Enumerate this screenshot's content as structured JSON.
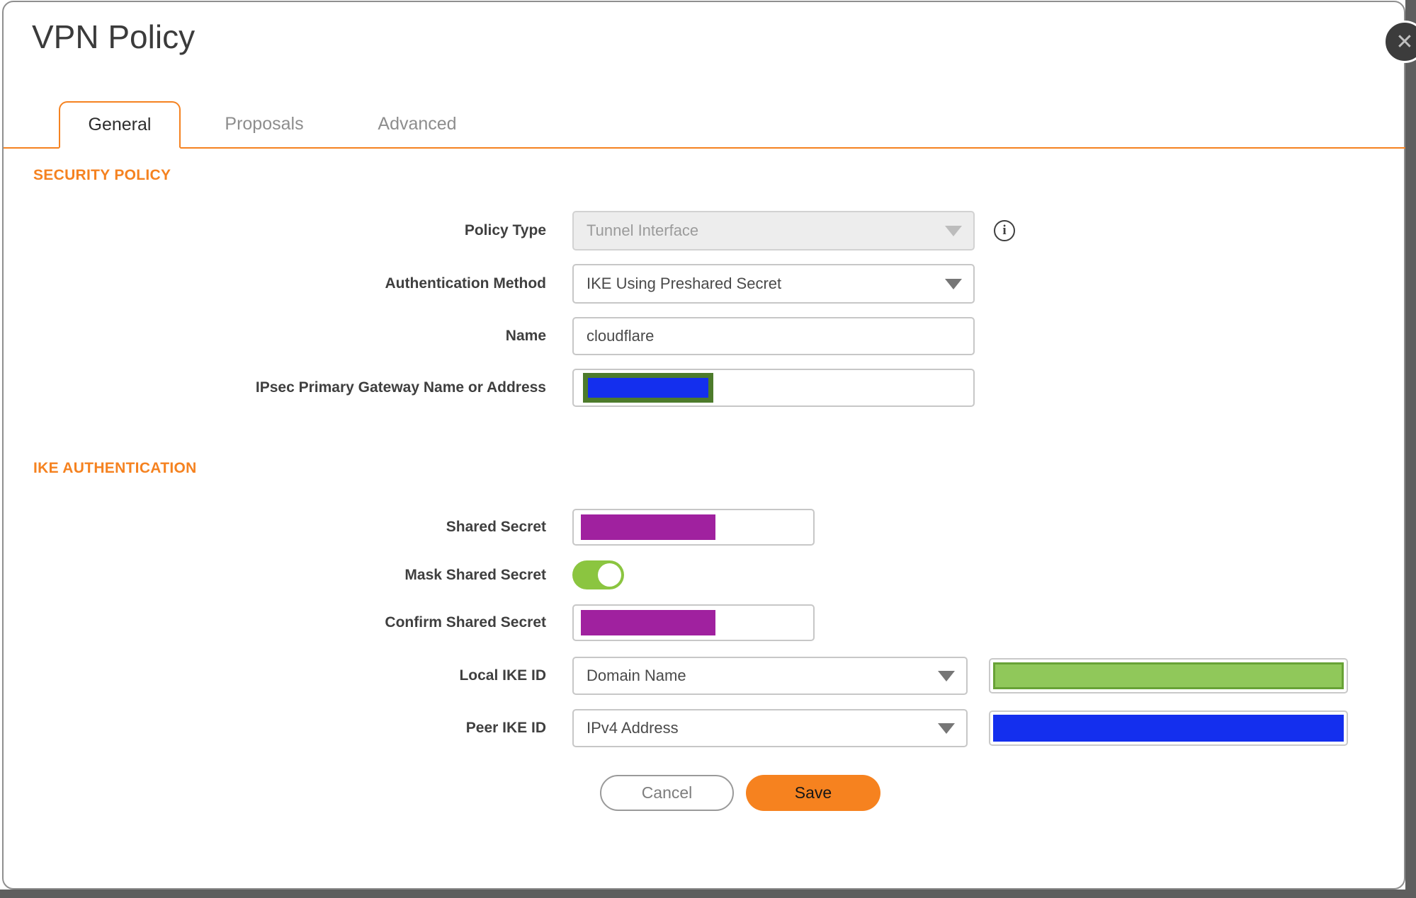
{
  "dialog": {
    "title": "VPN Policy",
    "close_icon": "✕",
    "info_icon": "i"
  },
  "tabs": [
    {
      "label": "General",
      "active": true
    },
    {
      "label": "Proposals",
      "active": false
    },
    {
      "label": "Advanced",
      "active": false
    }
  ],
  "sections": {
    "security_policy": "SECURITY POLICY",
    "ike_authentication": "IKE AUTHENTICATION"
  },
  "fields": {
    "policy_type": {
      "label": "Policy Type",
      "value": "Tunnel Interface",
      "disabled": true
    },
    "authentication_method": {
      "label": "Authentication Method",
      "value": "IKE Using Preshared Secret"
    },
    "name": {
      "label": "Name",
      "value": "cloudflare"
    },
    "gateway": {
      "label": "IPsec Primary Gateway Name or Address",
      "value": ""
    },
    "shared_secret": {
      "label": "Shared Secret",
      "value": ""
    },
    "mask_shared_secret": {
      "label": "Mask Shared Secret",
      "enabled": true
    },
    "confirm_shared_secret": {
      "label": "Confirm Shared Secret",
      "value": ""
    },
    "local_ike_id": {
      "label": "Local IKE ID",
      "value": "Domain Name"
    },
    "peer_ike_id": {
      "label": "Peer IKE ID",
      "value": "IPv4 Address"
    }
  },
  "buttons": {
    "cancel": "Cancel",
    "save": "Save"
  },
  "colors": {
    "accent_orange": "#f6821f",
    "section_orange": "#f58220",
    "toggle_green": "#8bc540",
    "redaction_purple": "#a0219f",
    "redaction_blue": "#142fee",
    "redaction_green_fill": "#90c85a",
    "redaction_green_border": "#68a236",
    "redaction_gateway_border": "#4d7b2b",
    "edge_gray": "#5e5e5e"
  }
}
